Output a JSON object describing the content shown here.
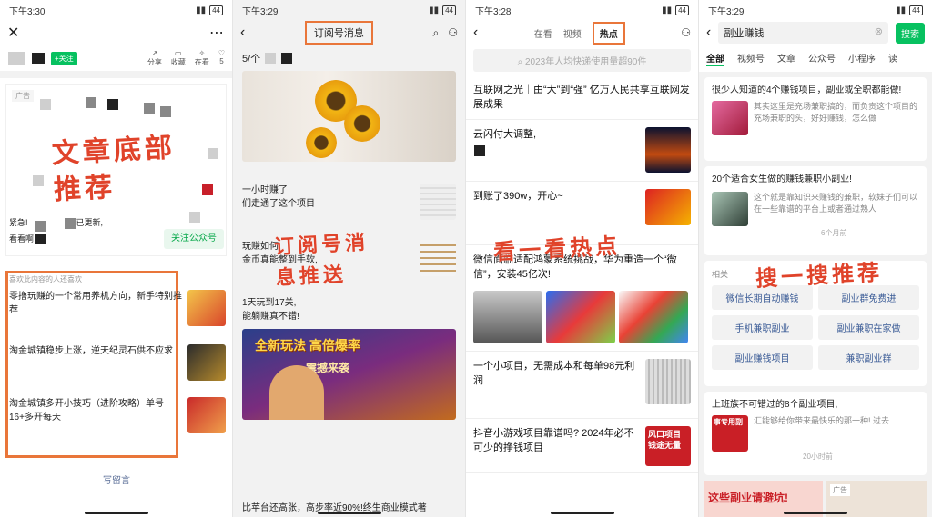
{
  "p1": {
    "time": "下午3:30",
    "follow_tag": "+关注",
    "actions": [
      {
        "label": "分享",
        "icon": "share-icon"
      },
      {
        "label": "收藏",
        "icon": "bookmark-icon"
      },
      {
        "label": "在看",
        "icon": "eye-icon"
      },
      {
        "label": "5",
        "icon": "like-icon"
      }
    ],
    "ad_tag": "广告",
    "annotation": "文章底部推荐",
    "notice_prefix": "紧急!",
    "notice_line2": "看看啊",
    "notice_suffix": "已更新,",
    "follow_button": "关注公众号",
    "recommend_header": "喜欢此内容的人还喜欢",
    "recs": [
      {
        "title": "零撸玩赚的一个常用养机方向，新手特别推荐"
      },
      {
        "title": "淘金城镇稳步上涨，逆天纪灵石供不应求"
      },
      {
        "title": "淘金城镇多开小技巧（进阶攻略）单号16+多开每天"
      }
    ],
    "comment": "写留言"
  },
  "p2": {
    "time": "下午3:29",
    "title": "订阅号消息",
    "count": "5/个",
    "annotation": "订阅号消息推送",
    "items": [
      {
        "title": "一小时赚了",
        "sub": "们走通了这个项目"
      },
      {
        "title": "玩赚如何",
        "sub": "金币真能整到手软,"
      },
      {
        "title": "1天玩到17关,",
        "sub": "能躺赚真不错!"
      }
    ],
    "banner_line1": "全新玩法 高倍爆率",
    "banner_line2": "震撼来袭",
    "bottom": "比苹台还高张，高步率近90%!终生商业模式著"
  },
  "p3": {
    "time": "下午3:28",
    "tabs": [
      "在看",
      "视频",
      "热点"
    ],
    "search_placeholder": "2023年人均快递使用量超90件",
    "annotation": "看一看热点",
    "news": [
      {
        "title": "互联网之光｜由“大”到“强” 亿万人民共享互联网发展成果"
      },
      {
        "title": "云闪付大调整,"
      },
      {
        "title": "到账了390w，开心~"
      },
      {
        "title": "微信面临适配鸿蒙系统挑战，华为重造一个“微信”，安装45亿次!"
      },
      {
        "title": "一个小项目，无需成本和每单98元利润"
      },
      {
        "title": "抖音小游戏项目靠谱吗? 2024年必不可少的挣钱项目"
      }
    ],
    "promo_text": "风口项目 钱途无量"
  },
  "p4": {
    "time": "下午3:29",
    "query": "副业赚钱",
    "search_btn": "搜索",
    "tabs": [
      "全部",
      "视频号",
      "文章",
      "公众号",
      "小程序",
      "读"
    ],
    "annotation": "搜一搜推荐",
    "r1_title": "很少人知道的4个赚钱项目，副业或全职都能做!",
    "r1_snip": "其实这里是充场兼职搞的，而负责这个项目的充场兼职的头，好好赚钱，怎么做",
    "r2_title": "20个适合女生做的赚钱兼职小副业!",
    "r2_snip": "这个就是靠知识来赚钱的兼职，软妹子们可以在一些靠谱的平台上或者通过熟人",
    "r2_time": "6个月前",
    "related": "相关",
    "pills": [
      "微信长期自动赚钱",
      "副业群免费进",
      "手机兼职副业",
      "副业兼职在家做",
      "副业赚钱项目",
      "兼职副业群"
    ],
    "r3_title": "上班族不可错过的8个副业项目,",
    "r3_snip": "汇能够给你带来最快乐的那一种! 过去",
    "r3_time": "20小时前",
    "r3_thumb": "事专用副",
    "bottom_banner": "这些副业请避坑!",
    "bottom_ad": "广告"
  }
}
